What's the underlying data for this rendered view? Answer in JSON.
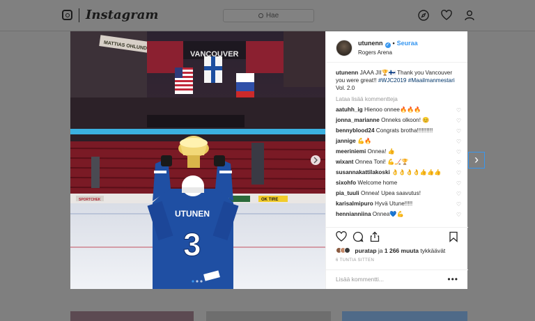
{
  "app": {
    "logo_text": "Instagram"
  },
  "search": {
    "placeholder": "Hae"
  },
  "nav_icons": [
    "compass-icon",
    "heart-icon",
    "profile-icon"
  ],
  "post": {
    "username": "utunenn",
    "follow_label": "Seuraa",
    "location": "Rogers Arena",
    "caption_user": "utunenn",
    "caption_text": "JAAA JII🏆🇫🇮 Thank you Vancouver you were great!! ",
    "caption_tags": "#WJC2019 #Maailmanmestari",
    "caption_tail": " Vol. 2.0",
    "load_more": "Lataa lisää kommentteja",
    "comments": [
      {
        "user": "aatuhh_ig",
        "text": "Hienoo onnee🔥🔥🔥"
      },
      {
        "user": "jonna_marianne",
        "text": "Onneks olkoon! 😊"
      },
      {
        "user": "bennyblood24",
        "text": "Congrats brotha!!!!!!!!!!"
      },
      {
        "user": "jannige",
        "text": "💪🔥"
      },
      {
        "user": "meeriniemi",
        "text": "Onnea! 👍"
      },
      {
        "user": "wixant",
        "text": "Onnea Toni! 💪🏒🏆"
      },
      {
        "user": "susannakattilakoski",
        "text": "👌👌👌👌👍👍👍"
      },
      {
        "user": "sixohfo",
        "text": "Welcome home"
      },
      {
        "user": "pia_tuuli",
        "text": "Onnea! Upea saavutus!"
      },
      {
        "user": "karisalmipuro",
        "text": "Hyvä Utune!!!!!"
      },
      {
        "user": "hennianniina",
        "text": "Onnea💙💪"
      }
    ],
    "likes_user": "puratap",
    "likes_mid": " ja ",
    "likes_count": "1 266 muuta",
    "likes_suffix": " tykkäävät",
    "time": "6 TUNTIA SITTEN",
    "add_comment": "Lisää kommentti...",
    "more_dots": "•••"
  },
  "photo": {
    "jersey_name": "UTUNEN",
    "jersey_number": "3",
    "banner_text": "VANCOUVER",
    "name_sign": "MATTIAS OHLUND",
    "boards": [
      "SPORTCHEK",
      "OK TIRE",
      "ACTION"
    ],
    "carousel_dots": 3
  },
  "colors": {
    "accent": "#3897f0",
    "overlay": "#7f7f7f"
  }
}
